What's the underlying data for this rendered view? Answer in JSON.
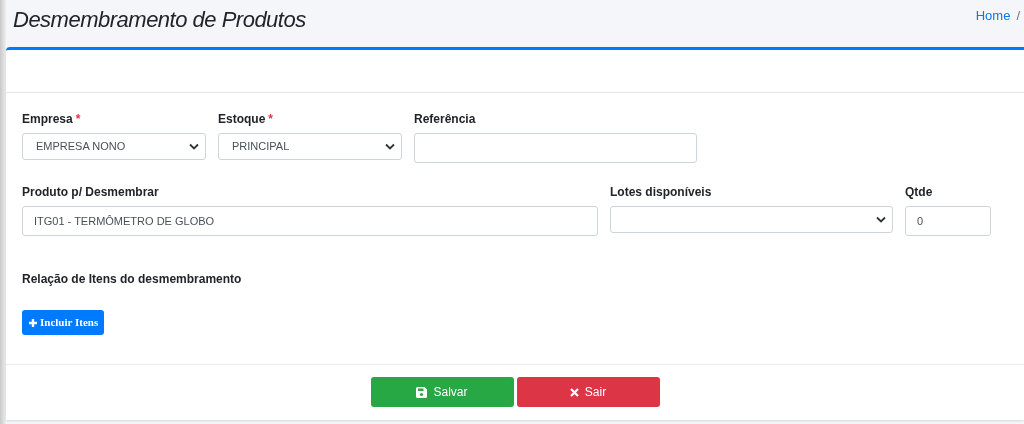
{
  "page_title": "Desmembramento de Produtos",
  "breadcrumb": {
    "items": [
      "Home"
    ],
    "separator": "/"
  },
  "form_rows": [
    [
      {
        "label": "Empresa",
        "required_mark": "*",
        "kind": "select",
        "value": "EMPRESA NONO"
      },
      {
        "label": "Estoque",
        "required_mark": "*",
        "kind": "select",
        "value": "PRINCIPAL"
      },
      {
        "label": "Referência",
        "kind": "input"
      }
    ],
    [
      {
        "label": "Produto p/ Desmembrar",
        "kind": "input",
        "value": "ITG01 - TERMÔMETRO DE GLOBO"
      },
      {
        "label": "Lotes disponíveis",
        "kind": "select"
      },
      {
        "label": "Qtde",
        "kind": "input",
        "value": "0"
      }
    ]
  ],
  "items_section": {
    "title": "Relação de Itens do desmembramento",
    "add_button": "Incluir Itens"
  },
  "footer_buttons": [
    {
      "label": "Salvar",
      "kind": "save"
    },
    {
      "label": "Sair",
      "kind": "exit"
    }
  ]
}
